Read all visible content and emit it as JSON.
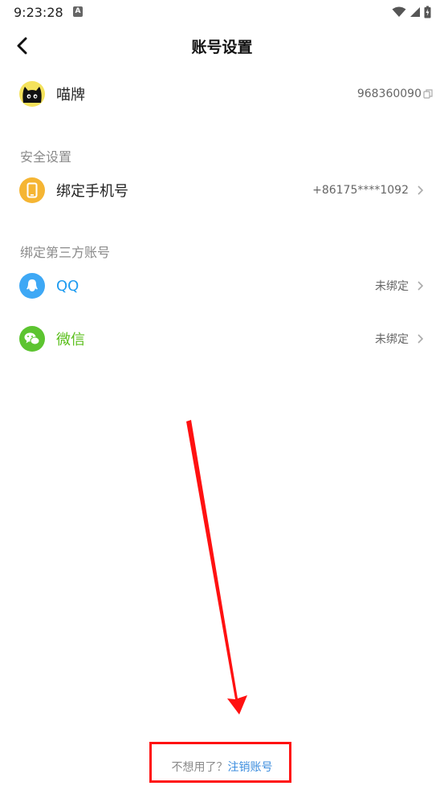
{
  "status": {
    "time": "9:23:28",
    "notif": "A"
  },
  "header": {
    "title": "账号设置"
  },
  "profile": {
    "name": "喵牌",
    "id": "968360090"
  },
  "security": {
    "section_title": "安全设置",
    "phone_label": "绑定手机号",
    "phone_value": "+86175****1092"
  },
  "third_party": {
    "section_title": "绑定第三方账号",
    "items": [
      {
        "label": "QQ",
        "value": "未绑定",
        "color": "#1e9bf0"
      },
      {
        "label": "微信",
        "value": "未绑定",
        "color": "#5bbf1c"
      }
    ]
  },
  "footer": {
    "prefix": "不想用了？",
    "link": "注销账号"
  },
  "colors": {
    "accent_link": "#3c8dde",
    "annotation": "#ff1111",
    "phone_icon": "#f5b533",
    "qq_icon": "#3ea8f5",
    "wechat_icon": "#5cc430"
  }
}
